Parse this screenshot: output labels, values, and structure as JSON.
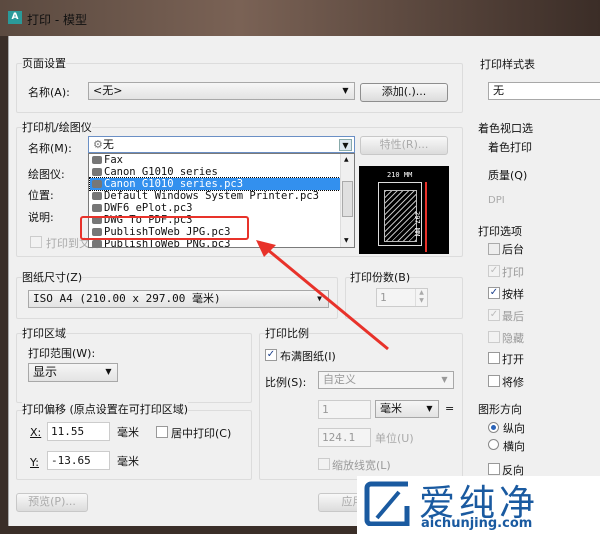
{
  "window": {
    "title": "打印 - 模型",
    "icon": "autocad-icon"
  },
  "page_setup": {
    "label": "页面设置",
    "name_label": "名称(A):",
    "name_value": "<无>",
    "add_button": "添加(.)..."
  },
  "printer": {
    "label": "打印机/绘图仪",
    "name_label": "名称(M):",
    "name_value": "无",
    "properties_button": "特性(R)...",
    "plotter_label": "绘图仪:",
    "location_label": "位置:",
    "description_label": "说明:",
    "print_to_file": "打印到文件",
    "options": [
      "Fax",
      "Canon G1010 series",
      "Canon G1010 series.pc3",
      "Default Windows System Printer.pc3",
      "DWF6 ePlot.pc3",
      "DWG To PDF.pc3",
      "PublishToWeb JPG.pc3",
      "PublishToWeb PNG.pc3"
    ],
    "selected_index": 2,
    "highlighted": "PublishToWeb JPG.pc3"
  },
  "preview": {
    "width_label": "210 MM",
    "height_label": "297 MM"
  },
  "paper_size": {
    "label": "图纸尺寸(Z)",
    "value": "ISO A4 (210.00 x 297.00 毫米)"
  },
  "copies": {
    "label": "打印份数(B)",
    "value": "1"
  },
  "plot_area": {
    "label": "打印区域",
    "range_label": "打印范围(W):",
    "range_value": "显示"
  },
  "plot_offset": {
    "label": "打印偏移 (原点设置在可打印区域)",
    "x_label": "X:",
    "x_value": "11.55",
    "y_label": "Y:",
    "y_value": "-13.65",
    "unit": "毫米",
    "center_label": "居中打印(C)"
  },
  "plot_scale": {
    "label": "打印比例",
    "fit_label": "布满图纸(I)",
    "fit_checked": true,
    "scale_label": "比例(S):",
    "scale_value": "自定义",
    "value1": "1",
    "unit_value": "毫米",
    "equals": "=",
    "value2": "124.1",
    "units_label": "单位(U)",
    "scale_lineweights": "缩放线宽(L)"
  },
  "buttons": {
    "preview": "预览(P)...",
    "apply": "应用到"
  },
  "right": {
    "style_table_label": "打印样式表",
    "style_table_value": "无",
    "shaded_label": "着色视口选",
    "shade_plot_label": "着色打印",
    "quality_label": "质量(Q)",
    "dpi_label": "DPI",
    "options_label": "打印选项",
    "options": [
      {
        "label": "后台",
        "checked": false,
        "disabled": false
      },
      {
        "label": "打印",
        "checked": true,
        "disabled": true
      },
      {
        "label": "按样",
        "checked": true,
        "disabled": false
      },
      {
        "label": "最后",
        "checked": true,
        "disabled": true
      },
      {
        "label": "隐藏",
        "checked": false,
        "disabled": true
      },
      {
        "label": "打开",
        "checked": false,
        "disabled": false
      },
      {
        "label": "将修",
        "checked": false,
        "disabled": false
      }
    ],
    "orientation_label": "图形方向",
    "portrait": "纵向",
    "landscape": "横向",
    "reverse": "反向"
  },
  "watermark": {
    "cn": "爱纯净",
    "url": "aichunjing.com"
  },
  "colors": {
    "selection": "#3390ee",
    "annotation": "#e8322a"
  }
}
